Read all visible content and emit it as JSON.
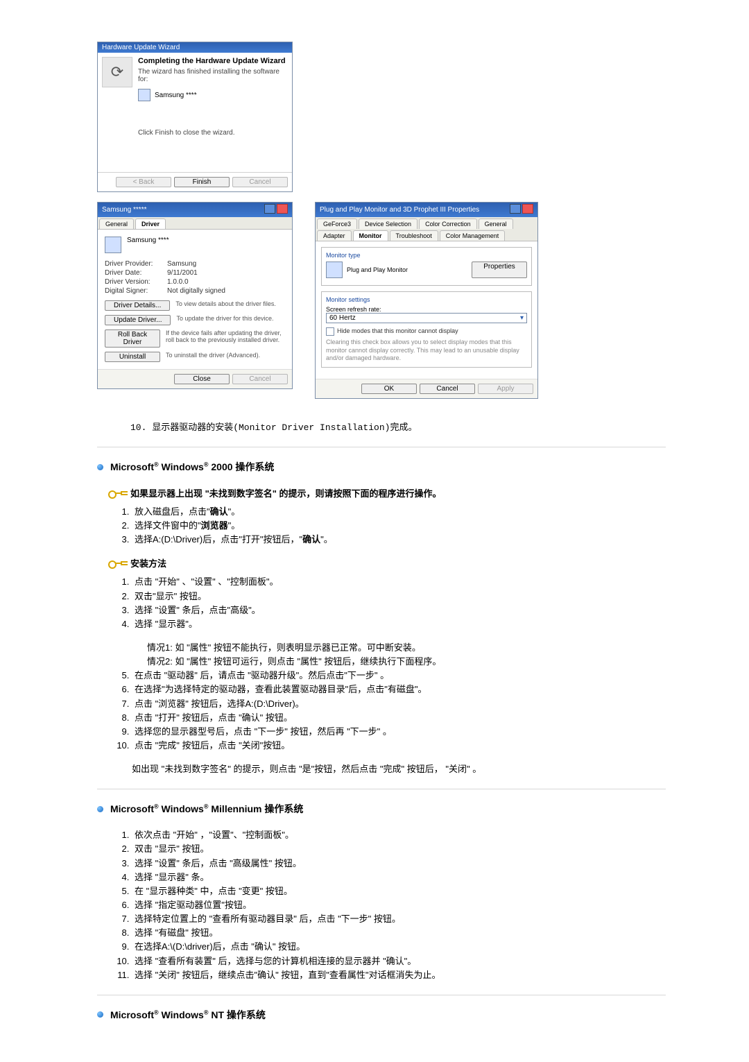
{
  "wizard": {
    "title": "Hardware Update Wizard",
    "heading": "Completing the Hardware Update Wizard",
    "line1": "The wizard has finished installing the software for:",
    "device": "Samsung ****",
    "line2": "Click Finish to close the wizard.",
    "back": "< Back",
    "finish": "Finish",
    "cancel": "Cancel"
  },
  "driverDlg": {
    "title": "Samsung *****",
    "tabGeneral": "General",
    "tabDriver": "Driver",
    "device": "Samsung ****",
    "kProvider": "Driver Provider:",
    "vProvider": "Samsung",
    "kDate": "Driver Date:",
    "vDate": "9/11/2001",
    "kVersion": "Driver Version:",
    "vVersion": "1.0.0.0",
    "kSigner": "Digital Signer:",
    "vSigner": "Not digitally signed",
    "bDetails": "Driver Details...",
    "dDetails": "To view details about the driver files.",
    "bUpdate": "Update Driver...",
    "dUpdate": "To update the driver for this device.",
    "bRoll": "Roll Back Driver",
    "dRoll": "If the device fails after updating the driver, roll back to the previously installed driver.",
    "bUninstall": "Uninstall",
    "dUninstall": "To uninstall the driver (Advanced).",
    "close": "Close",
    "cancel": "Cancel"
  },
  "monitorDlg": {
    "title": "Plug and Play Monitor and 3D Prophet III Properties",
    "tabs": {
      "r1a": "GeForce3",
      "r1b": "Device Selection",
      "r1c": "Color Correction",
      "r2a": "General",
      "r2b": "Adapter",
      "r2c": "Monitor",
      "r2d": "Troubleshoot",
      "r2e": "Color Management"
    },
    "fs1": "Monitor type",
    "monType": "Plug and Play Monitor",
    "props": "Properties",
    "fs2": "Monitor settings",
    "refreshLbl": "Screen refresh rate:",
    "refreshVal": "60 Hertz",
    "hideModes": "Hide modes that this monitor cannot display",
    "note": "Clearing this check box allows you to select display modes that this monitor cannot display correctly. This may lead to an unusable display and/or damaged hardware.",
    "ok": "OK",
    "cancel": "Cancel",
    "apply": "Apply"
  },
  "step10": "10.  显示器驱动器的安装(Monitor Driver Installation)完成。",
  "w2000": {
    "heading_pre": "Microsoft",
    "heading_mid": " Windows",
    "heading_post": " 2000 操作系统",
    "sub1": "如果显示器上出现 \"未找到数字签名\" 的提示，则请按照下面的程序进行操作。",
    "l1a": "放入磁盘后，点击\"",
    "l1b": "确认",
    "l1c": "\"。",
    "l2a": "选择文件窗中的\"",
    "l2b": "浏览器",
    "l2c": "\"。",
    "l3a": "选择A:(D:\\Driver)后，点击\"打开\"按钮后，\"",
    "l3b": "确认",
    "l3c": "\"。",
    "sub2": "安装方法",
    "m1": "点击 \"开始\" 、\"设置\" 、\"控制面板\"。",
    "m2": "双击\"显示\" 按钮。",
    "m3": "选择 \"设置\" 条后，点击\"高级\"。",
    "m4": "选择 \"显示器\"。",
    "m4_c1": "情况1:  如 \"属性\" 按钮不能执行，则表明显示器已正常。可中断安装。",
    "m4_c2": "情况2:  如 \"属性\" 按钮可运行，则点击 \"属性\" 按钮后，继续执行下面程序。",
    "m5": "在点击 \"驱动器\" 后，请点击 \"驱动器升级\"。然后点击\"下一步\" 。",
    "m6": "在选择\"为选择特定的驱动器，查看此装置驱动器目录\"后，点击\"有磁盘\"。",
    "m7": "点击 \"浏览器\" 按钮后，选择A:(D:\\Driver)。",
    "m8": "点击 \"打开\" 按钮后，点击 \"确认\" 按钮。",
    "m9": "选择您的显示器型号后，点击 \"下一步\" 按钮，然后再 \"下一步\" 。",
    "m10": "点击 \"完成\" 按钮后，点击 \"关闭\"按钮。",
    "tail": "如出现 \"未找到数字签名\" 的提示，则点击 \"是\"按钮，然后点击 \"完成\" 按钮后， \"关闭\" 。"
  },
  "wme": {
    "heading_pre": "Microsoft",
    "heading_mid": " Windows",
    "heading_post": " Millennium 操作系统",
    "l1": "依次点击 \"开始\" ，\"设置\"、\"控制面板\"。",
    "l2": "双击 \"显示\" 按钮。",
    "l3": "选择 \"设置\" 条后，点击 \"高级属性\" 按钮。",
    "l4": "选择 \"显示器\" 条。",
    "l5": "在 \"显示器种类\" 中，点击 \"变更\" 按钮。",
    "l6": "选择 \"指定驱动器位置\"按钮。",
    "l7": "选择特定位置上的 \"查看所有驱动器目录\" 后，点击 \"下一步\" 按钮。",
    "l8": "选择 \"有磁盘\" 按钮。",
    "l9": "在选择A:\\(D:\\driver)后，点击 \"确认\" 按钮。",
    "l10": "选择 \"查看所有装置\" 后，选择与您的计算机相连接的显示器并 \"确认\"。",
    "l11": "选择 \"关闭\" 按钮后，继续点击\"确认\" 按钮，直到\"查看属性\"对话框消失为止。"
  },
  "wnt": {
    "heading_pre": "Microsoft",
    "heading_mid": " Windows",
    "heading_post": " NT 操作系统"
  }
}
